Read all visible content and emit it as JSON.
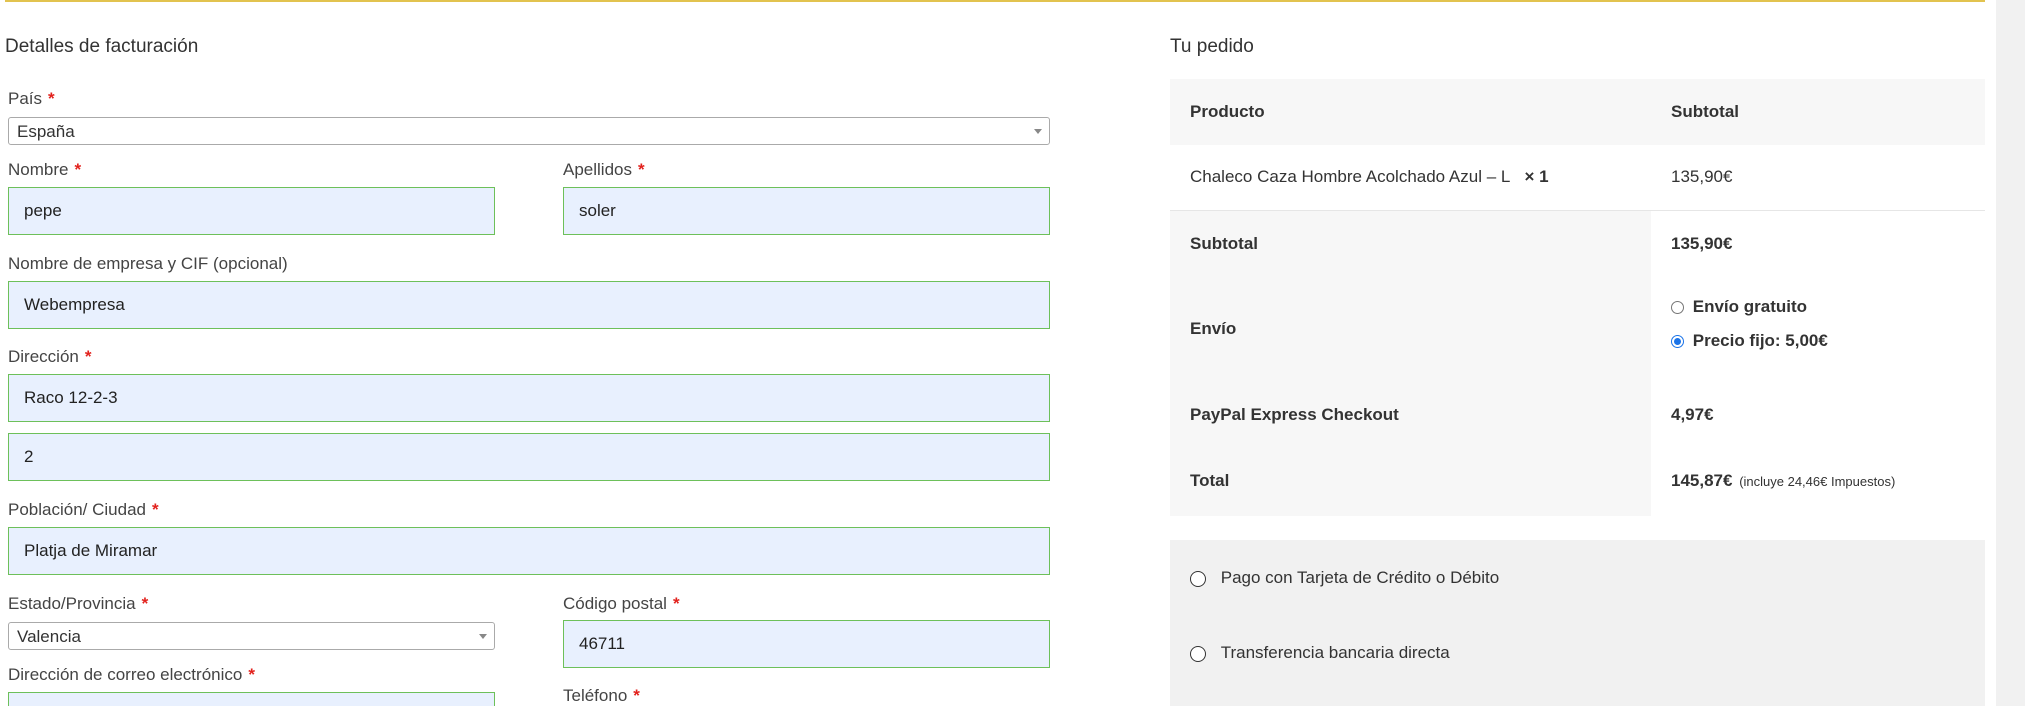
{
  "billing": {
    "title": "Detalles de facturación",
    "required_mark": "*",
    "country": {
      "label": "País",
      "value": "España"
    },
    "first_name": {
      "label": "Nombre",
      "value": "pepe"
    },
    "last_name": {
      "label": "Apellidos",
      "value": "soler"
    },
    "company": {
      "label": "Nombre de empresa y CIF (opcional)",
      "value": "Webempresa"
    },
    "address": {
      "label": "Dirección",
      "value": "Raco 12-2-3",
      "value2": "2"
    },
    "city": {
      "label": "Población/ Ciudad",
      "value": "Platja de Miramar"
    },
    "state": {
      "label": "Estado/Provincia",
      "value": "Valencia"
    },
    "postcode": {
      "label": "Código postal",
      "value": "46711"
    },
    "email": {
      "label": "Dirección de correo electrónico",
      "value": ""
    },
    "phone": {
      "label": "Teléfono",
      "value": ""
    }
  },
  "order": {
    "title": "Tu pedido",
    "header_product": "Producto",
    "header_subtotal": "Subtotal",
    "item_name": "Chaleco Caza Hombre Acolchado Azul – L",
    "item_qty": "× 1",
    "item_price": "135,90€",
    "subtotal_label": "Subtotal",
    "subtotal_value": "135,90€",
    "shipping_label": "Envío",
    "shipping_options": [
      {
        "label": "Envío gratuito",
        "selected": false
      },
      {
        "label": "Precio fijo: 5,00€",
        "selected": true
      }
    ],
    "paypal_label": "PayPal Express Checkout",
    "paypal_value": "4,97€",
    "total_label": "Total",
    "total_value": "145,87€",
    "total_tax_note": "(incluye 24,46€ Impuestos)"
  },
  "payment": {
    "methods": [
      {
        "label": "Pago con Tarjeta de Crédito o Débito"
      },
      {
        "label": "Transferencia bancaria directa"
      }
    ]
  },
  "colors": {
    "accent_line": "#e2c34f",
    "input_border": "#6dc05a",
    "input_bg": "#e8f0fe",
    "required": "#e2211c",
    "table_shade": "#f7f7f7"
  }
}
